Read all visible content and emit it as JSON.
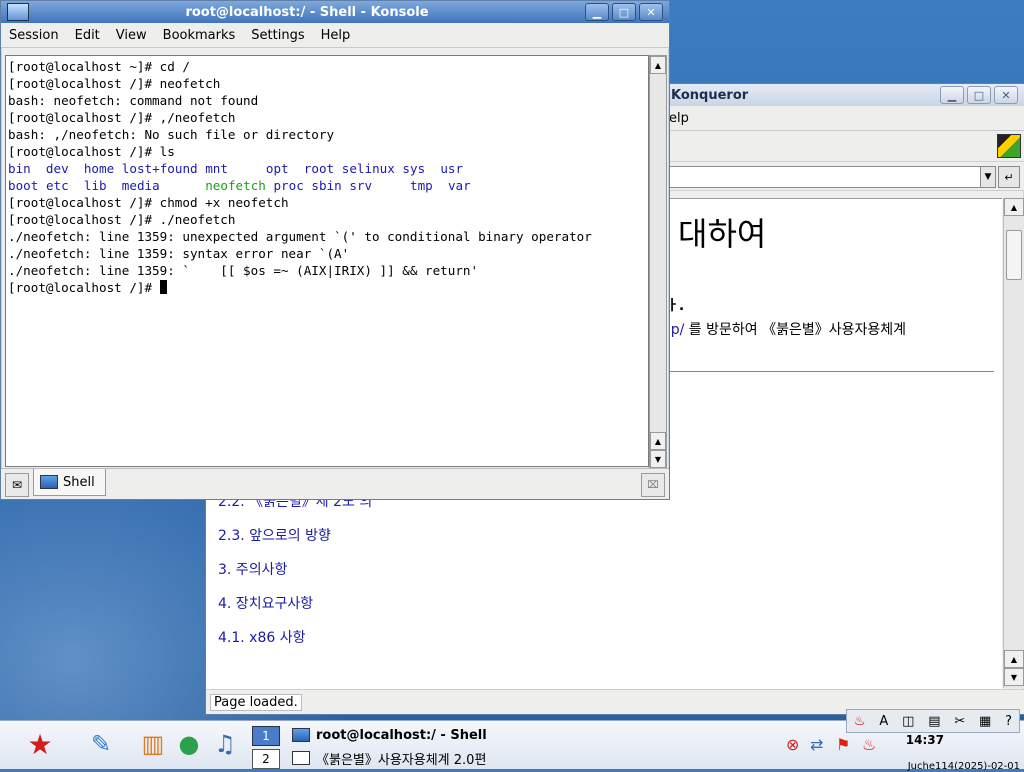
{
  "konsole": {
    "title": "root@localhost:/ - Shell - Konsole",
    "menu": [
      "Session",
      "Edit",
      "View",
      "Bookmarks",
      "Settings",
      "Help"
    ],
    "terminal_lines": [
      "[root@localhost ~]# cd /",
      "[root@localhost /]# neofetch",
      "bash: neofetch: command not found",
      "[root@localhost /]# ,/neofetch",
      "bash: ,/neofetch: No such file or directory",
      "[root@localhost /]# ls"
    ],
    "ls_row1": [
      "bin",
      "dev",
      "home",
      "lost+found",
      "mnt",
      "opt",
      "root",
      "selinux",
      "sys",
      "usr"
    ],
    "ls_row2": [
      "boot",
      "etc",
      "lib",
      "media",
      "neofetch",
      "proc",
      "sbin",
      "srv",
      "tmp",
      "var"
    ],
    "terminal_lines_after": [
      "[root@localhost /]# chmod +x neofetch",
      "[root@localhost /]# ./neofetch",
      "./neofetch: line 1359: unexpected argument `(' to conditional binary operator",
      "./neofetch: line 1359: syntax error near `(A'",
      "./neofetch: line 1359: `    [[ $os =~ (AIX|IRIX) ]] && return'"
    ],
    "prompt": "[root@localhost /]# ",
    "tab_label": "Shell",
    "colors": {
      "dir": "#1a1ab0",
      "exe": "#1aa01a"
    }
  },
  "konqueror": {
    "title": "Konqueror",
    "menu_fragment": "elp",
    "heading_fragment": "대하여",
    "line1_fragment": "ㅏ.",
    "line2_link": ":p/",
    "line2_text": " 를 방문하여 《붉은별》사용자용체계",
    "toc_partial": "2.2. 《붉은별》제 2도 의",
    "toc": [
      "2.3. 앞으로의 방향",
      "3. 주의사항",
      "4. 장치요구사항",
      "4.1. x86 사항"
    ],
    "status": "Page loaded."
  },
  "taskbar": {
    "desktops": [
      "1",
      "2"
    ],
    "tasks": [
      "root@localhost:/ - Shell",
      "《붉은별》사용자용체계 2.0편"
    ],
    "time": "14:37",
    "date": "Juche114(2025)-02-01"
  }
}
